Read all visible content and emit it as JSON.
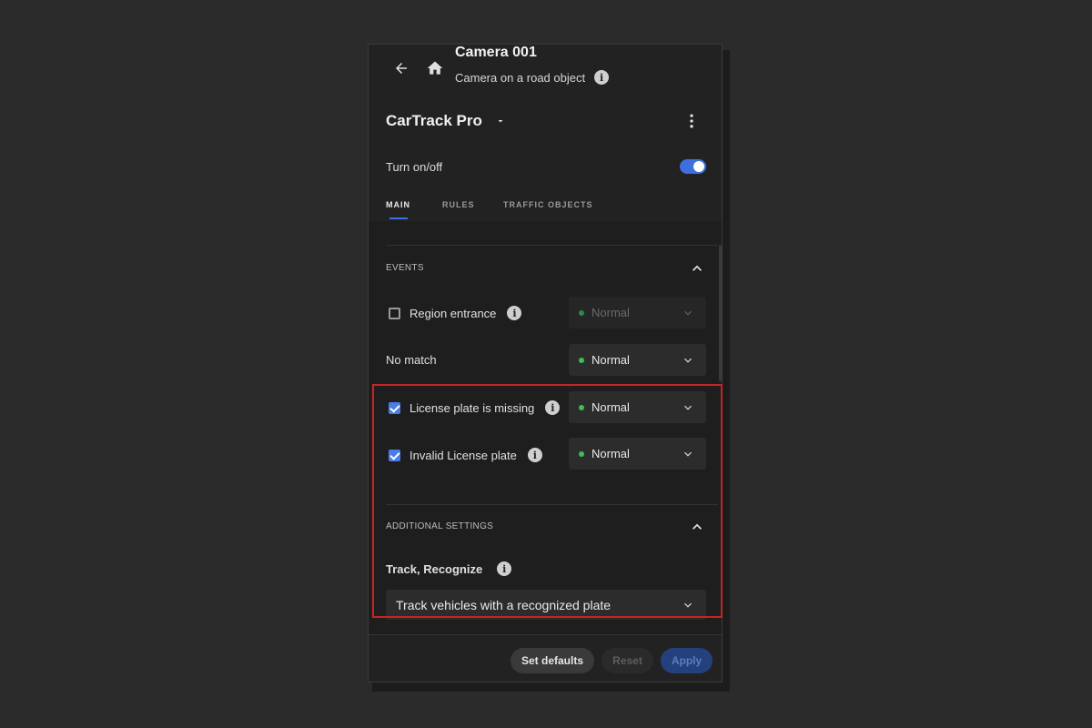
{
  "header": {
    "title": "Camera 001",
    "subtitle": "Camera on a road object",
    "product_name": "CarTrack Pro"
  },
  "toggle": {
    "label": "Turn on/off",
    "on": true
  },
  "tabs": [
    {
      "label": "MAIN",
      "active": true
    },
    {
      "label": "RULES",
      "active": false
    },
    {
      "label": "TRAFFIC OBJECTS",
      "active": false
    }
  ],
  "events": {
    "title": "EVENTS",
    "rows": [
      {
        "label": "Region entrance",
        "checked": false,
        "has_info": true,
        "severity": "Normal",
        "disabled": true
      },
      {
        "label": "No match",
        "checkbox": false,
        "severity": "Normal",
        "disabled": false
      },
      {
        "label": "License plate is missing",
        "checked": true,
        "has_info": true,
        "severity": "Normal",
        "disabled": false
      },
      {
        "label": "Invalid License plate",
        "checked": true,
        "has_info": true,
        "severity": "Normal",
        "disabled": false
      }
    ]
  },
  "additional": {
    "title": "ADDITIONAL SETTINGS",
    "track_label": "Track, Recognize",
    "track_value": "Track vehicles with a recognized plate"
  },
  "footer": {
    "set_defaults": "Set defaults",
    "reset": "Reset",
    "apply": "Apply"
  },
  "colors": {
    "accent": "#3d6fe0",
    "status_normal": "#3cbf5a",
    "highlight": "#c42525"
  }
}
